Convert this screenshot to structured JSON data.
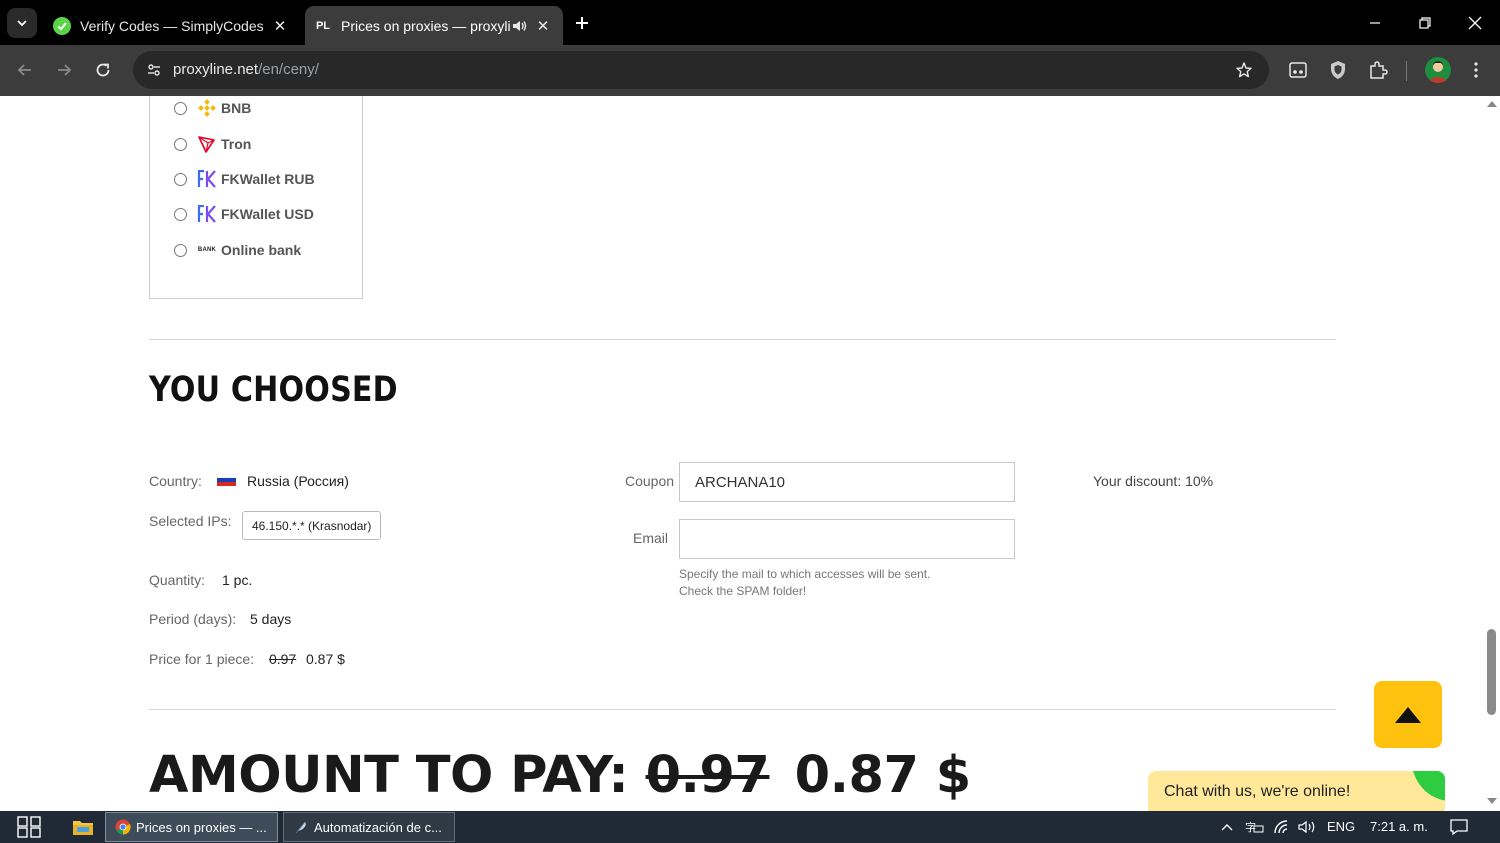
{
  "browser": {
    "tabs": [
      {
        "title": "Verify Codes — SimplyCodes",
        "favicon": "simplycodes-icon",
        "active": false
      },
      {
        "title": "Prices on proxies — proxyline",
        "favicon": "PL",
        "active": true
      }
    ],
    "url_host": "proxyline.net",
    "url_path": "/en/ceny/"
  },
  "payment_methods": [
    {
      "label": "BNB",
      "icon": "bnb-icon"
    },
    {
      "label": "Tron",
      "icon": "tron-icon"
    },
    {
      "label": "FKWallet RUB",
      "icon": "fkwallet-icon"
    },
    {
      "label": "FKWallet USD",
      "icon": "fkwallet-icon"
    },
    {
      "label": "Online bank",
      "icon": "bank-icon",
      "icon_text": "BANK"
    }
  ],
  "summary": {
    "heading": "YOU CHOOSED",
    "country_label": "Country:",
    "country_value": "Russia (Россия)",
    "ips_label": "Selected IPs:",
    "ip_value": "46.150.*.* (Krasnodar)",
    "quantity_label": "Quantity:",
    "quantity_value": "1 pc.",
    "period_label": "Period (days):",
    "period_value": "5 days",
    "price_label": "Price for 1 piece:",
    "price_old": "0.97",
    "price_new": "0.87 $",
    "coupon_label": "Coupon",
    "coupon_value": "ARCHANA10",
    "email_label": "Email",
    "email_value": "",
    "email_hint_1": "Specify the mail to which accesses will be sent.",
    "email_hint_2": "Check the SPAM folder!",
    "discount_text": "Your discount: 10%"
  },
  "amount": {
    "label": "AMOUNT TO PAY:",
    "old": "0.97",
    "new": "0.87 $"
  },
  "chat": {
    "text": "Chat with us, we're online!"
  },
  "taskbar": {
    "apps": [
      {
        "label": "Prices on proxies — ...",
        "icon": "chrome-icon",
        "active": true
      },
      {
        "label": "Automatización de c...",
        "icon": "feather-icon",
        "active": false
      }
    ],
    "language": "ENG",
    "time": "7:21 a. m."
  },
  "colors": {
    "accent": "#ffc20e",
    "chat_bg": "#ffe89a",
    "chrome_dark": "#3c3c3c"
  }
}
